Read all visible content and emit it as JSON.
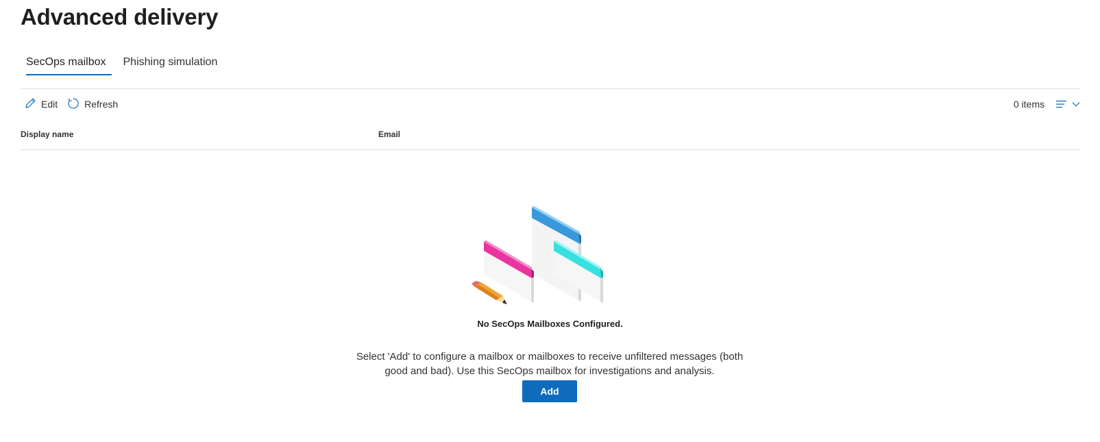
{
  "page": {
    "title": "Advanced delivery"
  },
  "tabs": [
    {
      "label": "SecOps mailbox",
      "active": true
    },
    {
      "label": "Phishing simulation",
      "active": false
    }
  ],
  "toolbar": {
    "edit_label": "Edit",
    "edit_icon": "pencil-icon",
    "refresh_label": "Refresh",
    "refresh_icon": "refresh-icon",
    "items_count": "0 items",
    "view_icon": "list-view-icon",
    "view_chevron_icon": "chevron-down-icon"
  },
  "table": {
    "columns": [
      "Display name",
      "Email"
    ],
    "rows": []
  },
  "empty_state": {
    "illustration": "empty-mailboxes-illustration",
    "title": "No SecOps Mailboxes Configured.",
    "description": "Select 'Add' to configure a mailbox or mailboxes to receive unfiltered messages (both good and bad). Use this SecOps mailbox for investigations and analysis.",
    "add_label": "Add"
  },
  "colors": {
    "accent": "#0f6cbd",
    "window_blue": "#3a9ad9",
    "window_pink": "#e8359f",
    "window_cyan": "#38e0e0",
    "pencil": "#f2a331"
  }
}
